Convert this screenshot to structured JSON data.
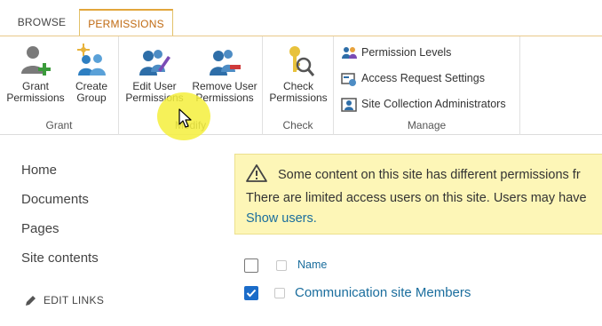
{
  "tabs": {
    "browse": "BROWSE",
    "permissions": "PERMISSIONS"
  },
  "ribbon": {
    "grant": {
      "label": "Grant",
      "grant_permissions": "Grant\nPermissions",
      "create_group": "Create\nGroup"
    },
    "modify": {
      "label": "Modify",
      "edit_user_permissions": "Edit User\nPermissions",
      "remove_user_permissions": "Remove User\nPermissions"
    },
    "check": {
      "label": "Check",
      "check_permissions": "Check\nPermissions"
    },
    "manage": {
      "label": "Manage",
      "permission_levels": "Permission Levels",
      "access_request_settings": "Access Request Settings",
      "site_collection_administrators": "Site Collection Administrators"
    }
  },
  "nav": {
    "home": "Home",
    "documents": "Documents",
    "pages": "Pages",
    "site_contents": "Site contents",
    "edit_links": "EDIT LINKS"
  },
  "warning": {
    "line1": "Some content on this site has different permissions fr",
    "line2": "There are limited access users on this site. Users may have",
    "show_users": "Show users."
  },
  "list": {
    "column_name": "Name",
    "rows": [
      {
        "name": "Communication site Members",
        "checked": true
      }
    ]
  },
  "colors": {
    "accent_tab": "#c06a12",
    "link": "#1a6d9d",
    "warning_bg": "#fdf6b7",
    "checkbox_checked": "#1b6cc9"
  }
}
